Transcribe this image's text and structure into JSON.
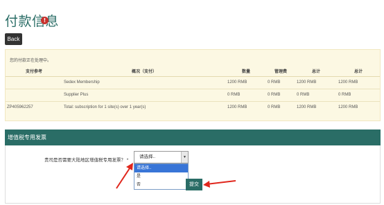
{
  "header": {
    "title": "付款信息",
    "info_icon": "!"
  },
  "back_label": "Back",
  "payment": {
    "status": "您的付款正在处理中。",
    "columns": [
      "支付参考",
      "概况（支付）",
      "数量",
      "管理费",
      "总计",
      "总计"
    ],
    "rows": [
      [
        "",
        "Sedex Membership",
        "1200 RMB",
        "0 RMB",
        "1200 RMB",
        "1200 RMB"
      ],
      [
        "",
        "Supplier Plus",
        "0 RMB",
        "0 RMB",
        "0 RMB",
        "0 RMB"
      ],
      [
        "ZP405962257",
        "Total: subscription for 1 site(s) over 1 year(s)",
        "1200 RMB",
        "0 RMB",
        "1200 RMB",
        "1200 RMB"
      ]
    ]
  },
  "vat": {
    "section_title": "增值税专用发票",
    "question": "贵司是否需要大陆地区增值税专用发票？ *",
    "select_value": "请选择..",
    "options": [
      "请选择..",
      "是",
      "否"
    ],
    "submit_label": "提交"
  },
  "colors": {
    "accent": "#2a6d66",
    "panel_bg": "#fcf8e3",
    "arrow": "#e0261c"
  }
}
